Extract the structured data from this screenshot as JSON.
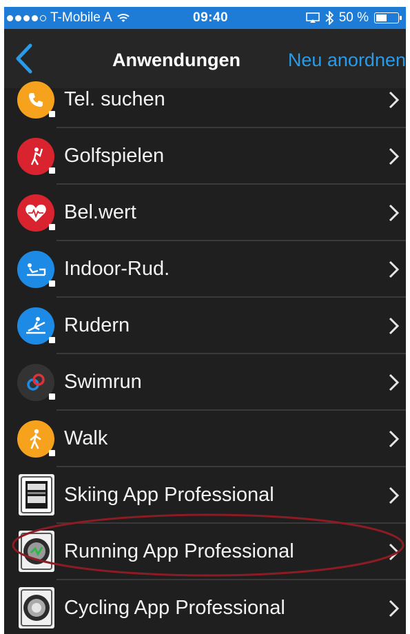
{
  "status_bar": {
    "carrier": "T-Mobile A",
    "time": "09:40",
    "battery": "50 %",
    "battery_level": 0.5
  },
  "nav": {
    "title": "Anwendungen",
    "action": "Neu anordnen",
    "back_icon": "chevron-left-icon"
  },
  "colors": {
    "statusbar_bg": "#1e7cd6",
    "accent": "#2a9be8",
    "background": "#1f1f1f",
    "highlight": "#8c1c24"
  },
  "apps": [
    {
      "label": "Tel. suchen",
      "icon": "phone-icon",
      "color": "#f6a21d"
    },
    {
      "label": "Golfspielen",
      "icon": "golfer-icon",
      "color": "#d9242f"
    },
    {
      "label": "Bel.wert",
      "icon": "heart-icon",
      "color": "#d9242f"
    },
    {
      "label": "Indoor-Rud.",
      "icon": "rowing-machine-icon",
      "color": "#1d8ae6"
    },
    {
      "label": "Rudern",
      "icon": "rowing-icon",
      "color": "#1d8ae6"
    },
    {
      "label": "Swimrun",
      "icon": "swimrun-icon",
      "color": "#333333"
    },
    {
      "label": "Walk",
      "icon": "walker-icon",
      "color": "#f6a21d"
    },
    {
      "label": "Skiing App Professional",
      "icon": "watch-face-icon",
      "color": "#f0f0f0"
    },
    {
      "label": "Running App Professional",
      "icon": "watch-icon",
      "color": "#f0f0f0"
    },
    {
      "label": "Cycling App Professional",
      "icon": "watch-icon",
      "color": "#f0f0f0"
    }
  ]
}
